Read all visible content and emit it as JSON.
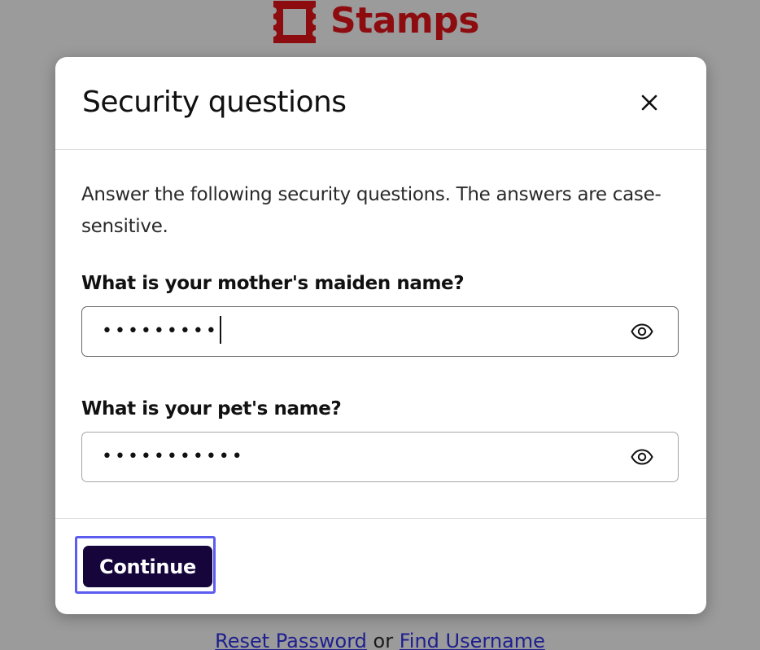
{
  "background": {
    "brand_name": "Stamps",
    "brand_color": "#8d0c10",
    "links": {
      "reset_password": "Reset Password",
      "separator": "or",
      "find_username": "Find Username"
    }
  },
  "modal": {
    "title": "Security questions",
    "close_icon": "close-icon",
    "intro": "Answer the following security questions. The answers are case-sensitive.",
    "questions": [
      {
        "label": "What is your mother's maiden name?",
        "value_masked": "•••••••••",
        "icon": "eye-icon"
      },
      {
        "label": "What is your pet's name?",
        "value_masked": "•••••••••••",
        "icon": "eye-icon"
      }
    ],
    "continue_label": "Continue",
    "colors": {
      "primary_button": "#15053a",
      "focus_ring": "#5b5cf0",
      "overlay": "#9b9b9b"
    }
  }
}
